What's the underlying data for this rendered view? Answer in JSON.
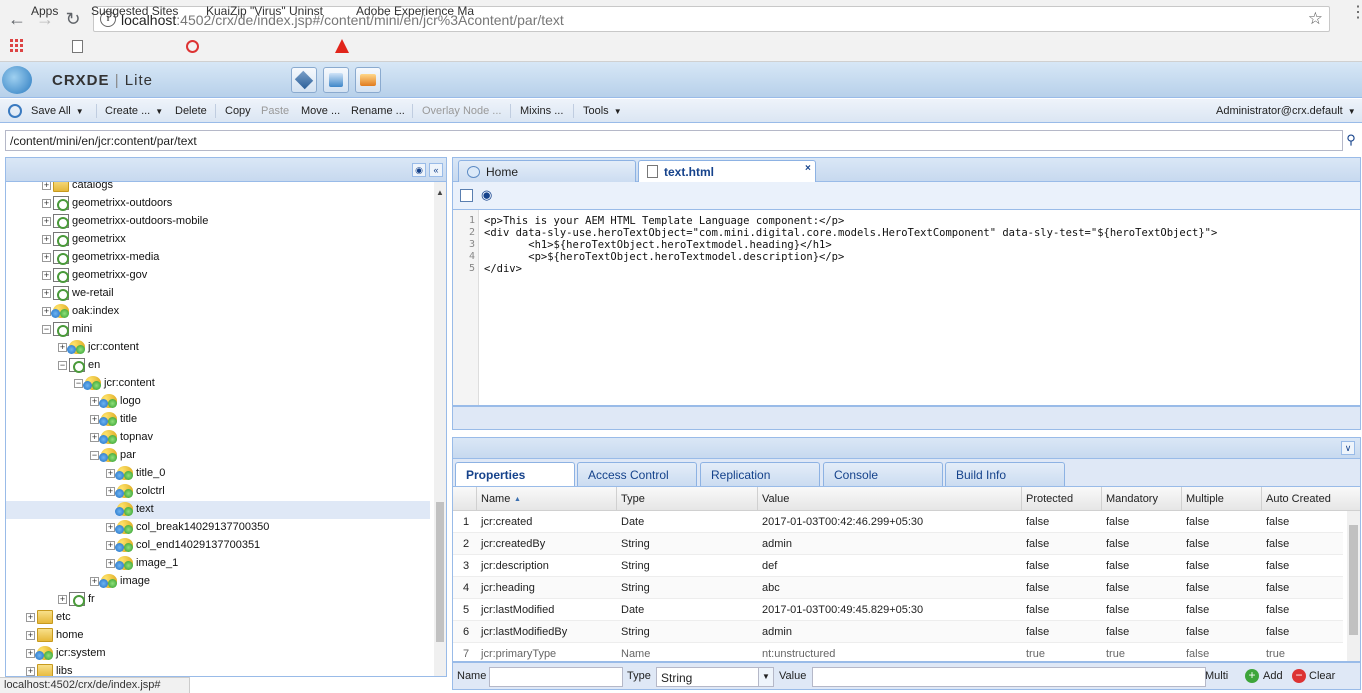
{
  "browser": {
    "url_host": "localhost",
    "url_rest": ":4502/crx/de/index.jsp#/content/mini/en/jcr%3Acontent/par/text",
    "bookmarks": [
      "Apps",
      "Suggested Sites",
      "KuaiZip \"Virus\" Uninst",
      "Adobe Experience Ma"
    ],
    "status_url": "localhost:4502/crx/de/index.jsp#"
  },
  "app": {
    "title": "CRXDE",
    "title_suffix": "Lite"
  },
  "toolbar": {
    "save_all": "Save All",
    "create": "Create ...",
    "delete": "Delete",
    "copy": "Copy",
    "paste": "Paste",
    "move": "Move ...",
    "rename": "Rename ...",
    "overlay": "Overlay Node ...",
    "mixins": "Mixins ...",
    "tools": "Tools",
    "user": "Administrator@crx.default"
  },
  "path": "/content/mini/en/jcr:content/par/text",
  "tree": [
    {
      "label": "catalogs",
      "icon": "folder",
      "exp": "+",
      "level": 2
    },
    {
      "label": "geometrixx-outdoors",
      "icon": "page",
      "exp": "+",
      "level": 2
    },
    {
      "label": "geometrixx-outdoors-mobile",
      "icon": "page",
      "exp": "+",
      "level": 2
    },
    {
      "label": "geometrixx",
      "icon": "page",
      "exp": "+",
      "level": 2
    },
    {
      "label": "geometrixx-media",
      "icon": "page",
      "exp": "+",
      "level": 2
    },
    {
      "label": "geometrixx-gov",
      "icon": "page",
      "exp": "+",
      "level": 2
    },
    {
      "label": "we-retail",
      "icon": "page",
      "exp": "+",
      "level": 2
    },
    {
      "label": "oak:index",
      "icon": "node3",
      "exp": "+",
      "level": 2
    },
    {
      "label": "mini",
      "icon": "page",
      "exp": "-",
      "level": 2
    },
    {
      "label": "jcr:content",
      "icon": "node3",
      "exp": "+",
      "level": 3
    },
    {
      "label": "en",
      "icon": "page",
      "exp": "-",
      "level": 3
    },
    {
      "label": "jcr:content",
      "icon": "node3",
      "exp": "-",
      "level": 4
    },
    {
      "label": "logo",
      "icon": "node3",
      "exp": "+",
      "level": 5
    },
    {
      "label": "title",
      "icon": "node3",
      "exp": "+",
      "level": 5
    },
    {
      "label": "topnav",
      "icon": "node3",
      "exp": "+",
      "level": 5
    },
    {
      "label": "par",
      "icon": "node3",
      "exp": "-",
      "level": 5
    },
    {
      "label": "title_0",
      "icon": "node3",
      "exp": "+",
      "level": 6
    },
    {
      "label": "colctrl",
      "icon": "node3",
      "exp": "+",
      "level": 6
    },
    {
      "label": "text",
      "icon": "node3",
      "exp": "",
      "level": 6,
      "selected": true
    },
    {
      "label": "col_break14029137700350",
      "icon": "node3",
      "exp": "+",
      "level": 6
    },
    {
      "label": "col_end14029137700351",
      "icon": "node3",
      "exp": "+",
      "level": 6
    },
    {
      "label": "image_1",
      "icon": "node3",
      "exp": "+",
      "level": 6
    },
    {
      "label": "image",
      "icon": "node3",
      "exp": "+",
      "level": 5
    },
    {
      "label": "fr",
      "icon": "page",
      "exp": "+",
      "level": 3
    },
    {
      "label": "etc",
      "icon": "folder",
      "exp": "+",
      "level": 1
    },
    {
      "label": "home",
      "icon": "folder",
      "exp": "+",
      "level": 1
    },
    {
      "label": "jcr:system",
      "icon": "node3",
      "exp": "+",
      "level": 1
    },
    {
      "label": "libs",
      "icon": "folder",
      "exp": "+",
      "level": 1
    }
  ],
  "editor": {
    "tabs": [
      "Home",
      "text.html"
    ],
    "lines": [
      "<p>This is your AEM HTML Template Language component:</p>",
      "<div data-sly-use.heroTextObject=\"com.mini.digital.core.models.HeroTextComponent\" data-sly-test=\"${heroTextObject}\">",
      "       <h1>${heroTextObject.heroTextmodel.heading}</h1>",
      "       <p>${heroTextObject.heroTextmodel.description}</p>",
      "</div>"
    ]
  },
  "bottom_tabs": [
    "Properties",
    "Access Control",
    "Replication",
    "Console",
    "Build Info"
  ],
  "properties": {
    "columns": [
      "Name",
      "Type",
      "Value",
      "Protected",
      "Mandatory",
      "Multiple",
      "Auto Created"
    ],
    "rows": [
      [
        "1",
        "jcr:created",
        "Date",
        "2017-01-03T00:42:46.299+05:30",
        "false",
        "false",
        "false",
        "false"
      ],
      [
        "2",
        "jcr:createdBy",
        "String",
        "admin",
        "false",
        "false",
        "false",
        "false"
      ],
      [
        "3",
        "jcr:description",
        "String",
        "def",
        "false",
        "false",
        "false",
        "false"
      ],
      [
        "4",
        "jcr:heading",
        "String",
        "abc",
        "false",
        "false",
        "false",
        "false"
      ],
      [
        "5",
        "jcr:lastModified",
        "Date",
        "2017-01-03T00:49:45.829+05:30",
        "false",
        "false",
        "false",
        "false"
      ],
      [
        "6",
        "jcr:lastModifiedBy",
        "String",
        "admin",
        "false",
        "false",
        "false",
        "false"
      ],
      [
        "7",
        "jcr:primaryType",
        "Name",
        "nt:unstructured",
        "true",
        "true",
        "false",
        "true"
      ]
    ]
  },
  "addbar": {
    "name_label": "Name",
    "type_label": "Type",
    "type_value": "String",
    "value_label": "Value",
    "multi": "Multi",
    "add": "Add",
    "clear": "Clear"
  }
}
